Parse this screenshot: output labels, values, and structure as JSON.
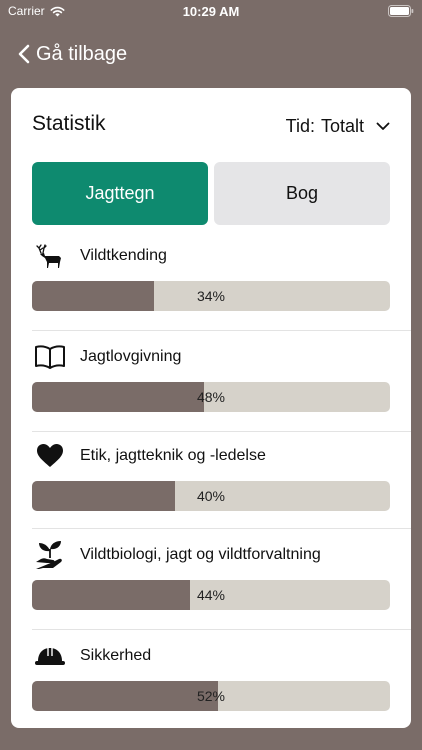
{
  "status_bar": {
    "carrier": "Carrier",
    "time": "10:29 AM"
  },
  "nav": {
    "back_label": "Gå tilbage"
  },
  "card": {
    "title": "Statistik",
    "time_filter": {
      "label": "Tid:",
      "value": "Totalt"
    },
    "segments": [
      {
        "label": "Jagttegn",
        "selected": true
      },
      {
        "label": "Bog",
        "selected": false
      }
    ],
    "stats": [
      {
        "icon": "deer-icon",
        "label": "Vildtkending",
        "percent": 34,
        "percent_text": "34%"
      },
      {
        "icon": "open-book-icon",
        "label": "Jagtlovgivning",
        "percent": 48,
        "percent_text": "48%"
      },
      {
        "icon": "heart-icon",
        "label": "Etik, jagtteknik og -ledelse",
        "percent": 40,
        "percent_text": "40%"
      },
      {
        "icon": "plant-in-hand-icon",
        "label": "Vildtbiologi, jagt og vildtforvaltning",
        "percent": 44,
        "percent_text": "44%"
      },
      {
        "icon": "hard-hat-icon",
        "label": "Sikkerhed",
        "percent": 52,
        "percent_text": "52%"
      }
    ]
  },
  "colors": {
    "background": "#7a6c68",
    "accent": "#0e8a6f",
    "bar_fill": "#7a6c68",
    "bar_track": "#d6d2ca"
  }
}
